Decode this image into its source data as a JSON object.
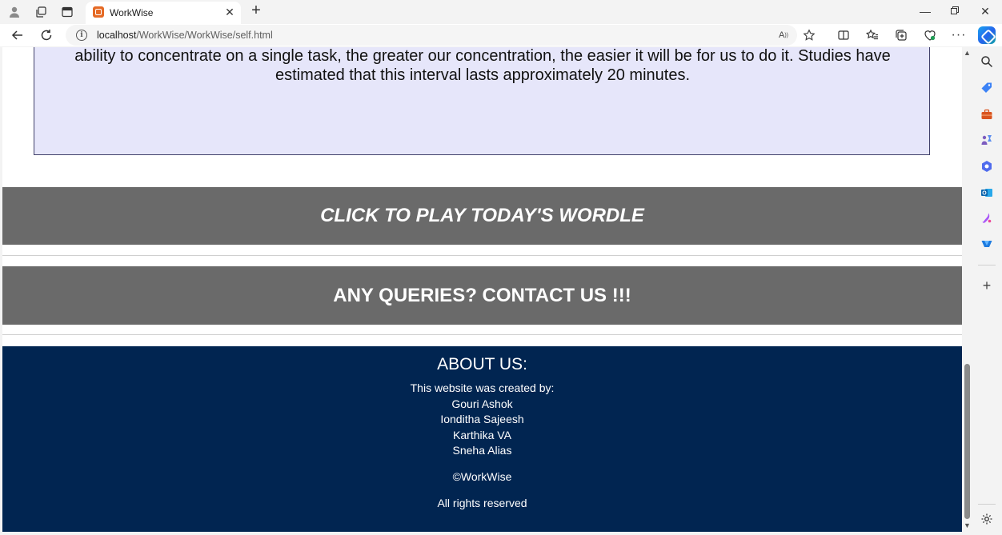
{
  "tab": {
    "title": "WorkWise"
  },
  "address": {
    "host": "localhost",
    "path": "/WorkWise/WorkWise/self.html"
  },
  "page": {
    "info_text": "ability to concentrate on a single task, the greater our concentration, the easier it will be for us to do it. Studies have estimated that this interval lasts approximately 20 minutes.",
    "wordle_button": "CLICK TO PLAY TODAY'S WORDLE",
    "contact_button": "ANY QUERIES? CONTACT US !!!",
    "footer": {
      "heading": "ABOUT US:",
      "created_by": "This website was created by:",
      "creators": [
        "Gouri Ashok",
        "Ionditha Sajeesh",
        "Karthika VA",
        "Sneha Alias"
      ],
      "copyright": "©WorkWise",
      "rights": "All rights reserved"
    }
  },
  "colors": {
    "info_box_bg": "#e6e6fa",
    "button_bg": "#6a6a6a",
    "footer_bg": "#012551"
  },
  "icons": {
    "tabstrip": [
      "profile-icon",
      "workspaces-icon",
      "vertical-tabs-icon"
    ],
    "toolbar": [
      "back-icon",
      "refresh-icon",
      "read-aloud-icon",
      "favorite-star-icon",
      "split-screen-icon",
      "favorites-icon",
      "collections-icon",
      "browser-essentials-icon",
      "more-icon",
      "copilot-icon"
    ],
    "sidebar": [
      "search-icon",
      "shopping-icon",
      "tools-icon",
      "games-icon",
      "m365-icon",
      "outlook-icon",
      "designer-icon",
      "drop-icon",
      "add-icon",
      "settings-icon"
    ]
  }
}
